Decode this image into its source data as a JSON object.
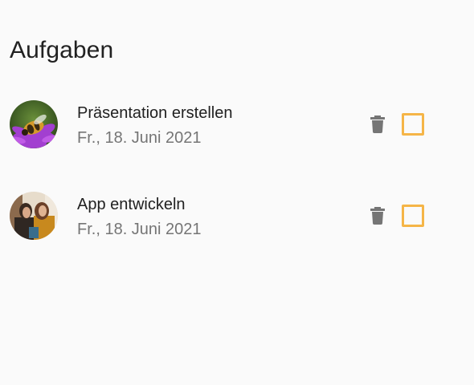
{
  "header": {
    "title": "Aufgaben"
  },
  "tasks": [
    {
      "title": "Präsentation erstellen",
      "date": "Fr., 18. Juni 2021",
      "avatar": "bee-on-flower-photo",
      "delete_icon": "trash-icon",
      "checked": false
    },
    {
      "title": "App entwickeln",
      "date": "Fr., 18. Juni 2021",
      "avatar": "couple-photo",
      "delete_icon": "trash-icon",
      "checked": false
    }
  ],
  "colors": {
    "background": "#fafafa",
    "title_text": "#212121",
    "secondary_text": "#757575",
    "icon": "#757575",
    "checkbox_accent": "#f5b547"
  }
}
